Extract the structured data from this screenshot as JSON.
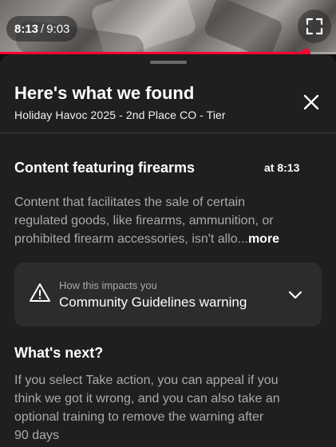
{
  "player": {
    "current_time": "8:13",
    "separator": "/",
    "duration": "9:03",
    "progress_fraction": 0.909,
    "fullscreen_icon": "fullscreen-icon"
  },
  "sheet": {
    "title": "Here's what we found",
    "subtitle": "Holiday Havoc 2025 - 2nd Place CO - Tier",
    "close_icon": "close-icon"
  },
  "violation": {
    "title": "Content featuring firearms",
    "timestamp": "at 8:13",
    "description_lines": [
      "Content that facilitates the sale of certain",
      "regulated goods, like firearms, ammunition, or",
      "prohibited firearm accessories, isn't allo..."
    ],
    "more_label": "more"
  },
  "impact": {
    "label": "How this impacts you",
    "value": "Community Guidelines warning",
    "icon": "warning-icon",
    "expand_icon": "chevron-down-icon"
  },
  "next": {
    "title": "What's next?",
    "lines": [
      "If you select Take action, you can appeal if you",
      "think we got it wrong, and you can also take an",
      "optional training to remove the warning after",
      "90 days"
    ]
  },
  "colors": {
    "accent": "#ff0033",
    "sheet_bg": "#1f1f1f",
    "card_bg": "#2c2c2c",
    "secondary_text": "#aaaaaa"
  }
}
